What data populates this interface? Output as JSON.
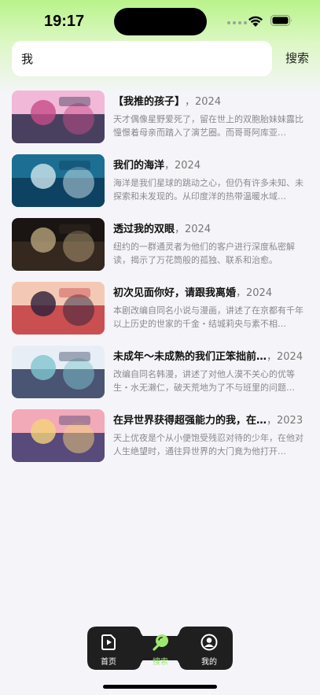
{
  "status_bar": {
    "time": "19:17"
  },
  "search": {
    "query": "我",
    "button_label": "搜索"
  },
  "results": [
    {
      "title": "【我推的孩子】",
      "year": "，2024",
      "desc": "天才偶像星野爱死了，留在世上的双胞胎妹妹露比憧憬着母亲而踏入了演艺圈。而哥哥阿库亚…",
      "thumb_colors": [
        "#f2b8d8",
        "#2b2a4a",
        "#c74b8a"
      ]
    },
    {
      "title": "我们的海洋",
      "year": "，2024",
      "desc": "海洋是我们星球的跳动之心，但仍有许多未知、未探索和未发现的。从印度洋的热带温暖水域…",
      "thumb_colors": [
        "#1c6f93",
        "#0c3b5a",
        "#cfe6ee"
      ]
    },
    {
      "title": "透过我的双眼",
      "year": "，2024",
      "desc": "纽约的一群通灵者为他们的客户进行深度私密解读，揭示了万花筒般的孤独、联系和治愈。",
      "thumb_colors": [
        "#1a1512",
        "#3a2c22",
        "#b7a27a"
      ]
    },
    {
      "title": "初次见面你好，请跟我离婚",
      "year": "，2024",
      "desc": "本剧改编自同名小说与漫画，讲述了在京都有千年以上历史的世家的千金・结城莉央与素不相…",
      "thumb_colors": [
        "#f3c9b6",
        "#c23a3f",
        "#2a1f3a"
      ]
    },
    {
      "title": "未成年～未成熟的我们正笨拙前…",
      "year": "，2024",
      "desc": "改编自同名韩漫，讲述了对他人漠不关心的优等生・水无濑仁，破天荒地为了不与班里的问题…",
      "thumb_colors": [
        "#e8eef5",
        "#2d3a5a",
        "#7fc6cf"
      ]
    },
    {
      "title": "在异世界获得超强能力的我，在…",
      "year": "，2023",
      "desc": "天上优夜是个从小便饱受残忍对待的少年，在他对人生绝望时，通往异世界的大门竟为他打开…",
      "thumb_colors": [
        "#f2a9b8",
        "#3d3a6e",
        "#f4d27a"
      ]
    }
  ],
  "tabbar": {
    "items": [
      {
        "label": "首页",
        "icon": "play-icon"
      },
      {
        "label": "搜索",
        "icon": "search-icon"
      },
      {
        "label": "我的",
        "icon": "user-icon"
      }
    ],
    "active_index": 1,
    "active_color": "#9fe870"
  }
}
